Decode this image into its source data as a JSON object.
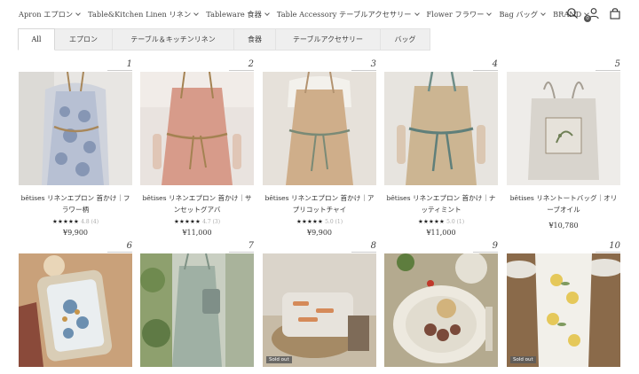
{
  "nav": {
    "items": [
      {
        "label": "Apron エプロン"
      },
      {
        "label": "Table&Kitchen Linen リネン"
      },
      {
        "label": "Tableware 食器"
      },
      {
        "label": "Table Accessory テーブルアクセサリー"
      },
      {
        "label": "Flower フラワー"
      },
      {
        "label": "Bag バッグ"
      },
      {
        "label": "BRAND"
      }
    ],
    "icons": [
      "search-icon",
      "account-icon",
      "cart-icon"
    ],
    "cart_count": "0"
  },
  "tabs": [
    {
      "label": "All",
      "active": true
    },
    {
      "label": "エプロン"
    },
    {
      "label": "テーブル＆キッチンリネン"
    },
    {
      "label": "食器"
    },
    {
      "label": "テーブルアクセサリー"
    },
    {
      "label": "バッグ"
    }
  ],
  "products": [
    {
      "num": "1",
      "title": "bêtises リネンエプロン 首かけ｜フラワー柄",
      "stars": "★★★★★",
      "rating": "4.8 (4)",
      "price": "¥9,900"
    },
    {
      "num": "2",
      "title": "bêtises リネンエプロン 首かけ｜サンセットグアバ",
      "stars": "★★★★★",
      "rating": "4.7 (3)",
      "price": "¥11,000"
    },
    {
      "num": "3",
      "title": "bêtises リネンエプロン 首かけ｜アプリコットチャイ",
      "stars": "★★★★★",
      "rating": "5.0 (1)",
      "price": "¥9,900"
    },
    {
      "num": "4",
      "title": "bêtises リネンエプロン 首かけ｜ナッティミント",
      "stars": "★★★★★",
      "rating": "5.0 (1)",
      "price": "¥11,000"
    },
    {
      "num": "5",
      "title": "bêtises リネントートバッグ｜オリーブオイル",
      "stars": "",
      "rating": "",
      "price": "¥10,780"
    },
    {
      "num": "6",
      "title": "",
      "sold_out": ""
    },
    {
      "num": "7",
      "title": "",
      "sold_out": ""
    },
    {
      "num": "8",
      "title": "",
      "sold_out": "Sold out"
    },
    {
      "num": "9",
      "title": "",
      "sold_out": ""
    },
    {
      "num": "10",
      "title": "",
      "sold_out": "Sold out"
    }
  ]
}
